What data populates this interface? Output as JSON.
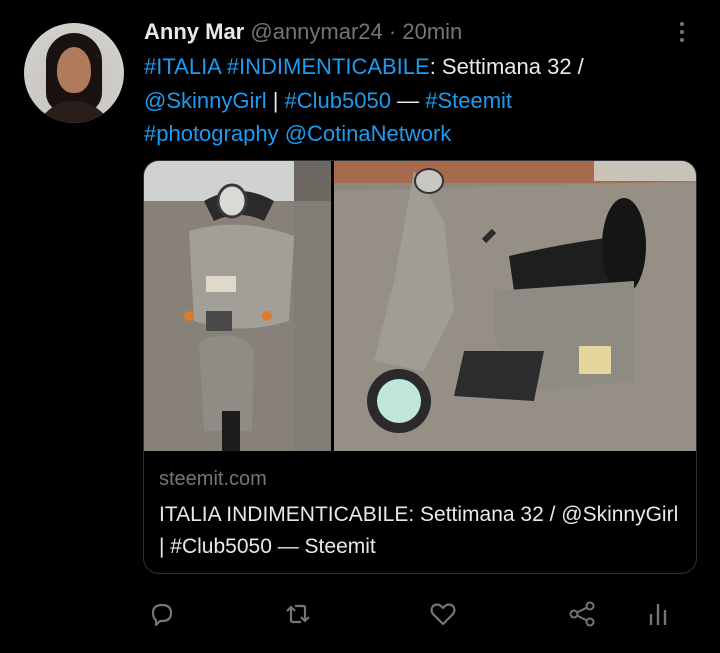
{
  "tweet": {
    "author_name": "Anny Mar",
    "handle": "@annymar24",
    "separator": "·",
    "time": "20min",
    "text_parts": {
      "tag1": "#ITALIA",
      "tag2": "#INDIMENTICABILE",
      "t1": ": Settimana 32 /",
      "mention1": "@SkinnyGirl",
      "t2": " | ",
      "tag3": "#Club5050",
      "t3": " — ",
      "tag4": "#Steemit",
      "tag5": "#photography",
      "mention2": "@CotinaNetwork"
    }
  },
  "card": {
    "domain": "steemit.com",
    "title": "ITALIA INDIMENTICABILE: Settimana 32 / @SkinnyGirl | #Club5050 — Steemit"
  },
  "icons": {
    "more": "more-vertical-icon",
    "reply": "reply-icon",
    "retweet": "retweet-icon",
    "like": "heart-icon",
    "share": "share-icon",
    "analytics": "analytics-icon"
  },
  "colors": {
    "background": "#000000",
    "text": "#e7e9ea",
    "muted": "#71767b",
    "link": "#1d9bf0",
    "border": "#2f3336"
  }
}
